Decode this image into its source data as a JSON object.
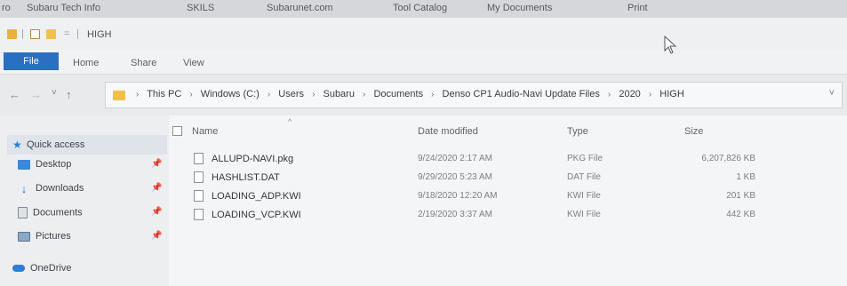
{
  "bookmarks": {
    "items": [
      "ro",
      "Subaru Tech Info",
      "SKILS",
      "Subarunet.com",
      "Tool Catalog",
      "My Documents",
      "Print"
    ]
  },
  "window": {
    "title": "HIGH",
    "qat_separator": "="
  },
  "ribbon": {
    "file_label": "File",
    "tabs": [
      "Home",
      "Share",
      "View"
    ],
    "file_color": "#2a6fc2"
  },
  "address": {
    "back_icon": "←",
    "forward_icon": "→",
    "recent_icon": "˅",
    "up_icon": "↑",
    "separator": "›",
    "crumbs": [
      "This PC",
      "Windows (C:)",
      "Users",
      "Subaru",
      "Documents",
      "Denso CP1 Audio-Navi Update Files",
      "2020",
      "HIGH"
    ],
    "dropdown_icon": "˅"
  },
  "navigation": {
    "quick_access": "Quick access",
    "items": [
      {
        "label": "Desktop",
        "icon": "desktop-icon",
        "pin": "📌"
      },
      {
        "label": "Downloads",
        "icon": "downloads-icon",
        "pin": "📌"
      },
      {
        "label": "Documents",
        "icon": "documents-icon",
        "pin": "📌"
      },
      {
        "label": "Pictures",
        "icon": "pictures-icon",
        "pin": "📌"
      }
    ],
    "onedrive": "OneDrive"
  },
  "file_list": {
    "columns": {
      "name": "Name",
      "date": "Date modified",
      "type": "Type",
      "size": "Size"
    },
    "sort_arrow": "^",
    "rows": [
      {
        "name": "ALLUPD-NAVI.pkg",
        "date": "9/24/2020 2:17 AM",
        "type": "PKG File",
        "size": "6,207,826 KB"
      },
      {
        "name": "HASHLIST.DAT",
        "date": "9/29/2020 5:23 AM",
        "type": "DAT File",
        "size": "1 KB"
      },
      {
        "name": "LOADING_ADP.KWI",
        "date": "9/18/2020 12:20 AM",
        "type": "KWI File",
        "size": "201 KB"
      },
      {
        "name": "LOADING_VCP.KWI",
        "date": "2/19/2020 3:37 AM",
        "type": "KWI File",
        "size": "442 KB"
      }
    ]
  }
}
